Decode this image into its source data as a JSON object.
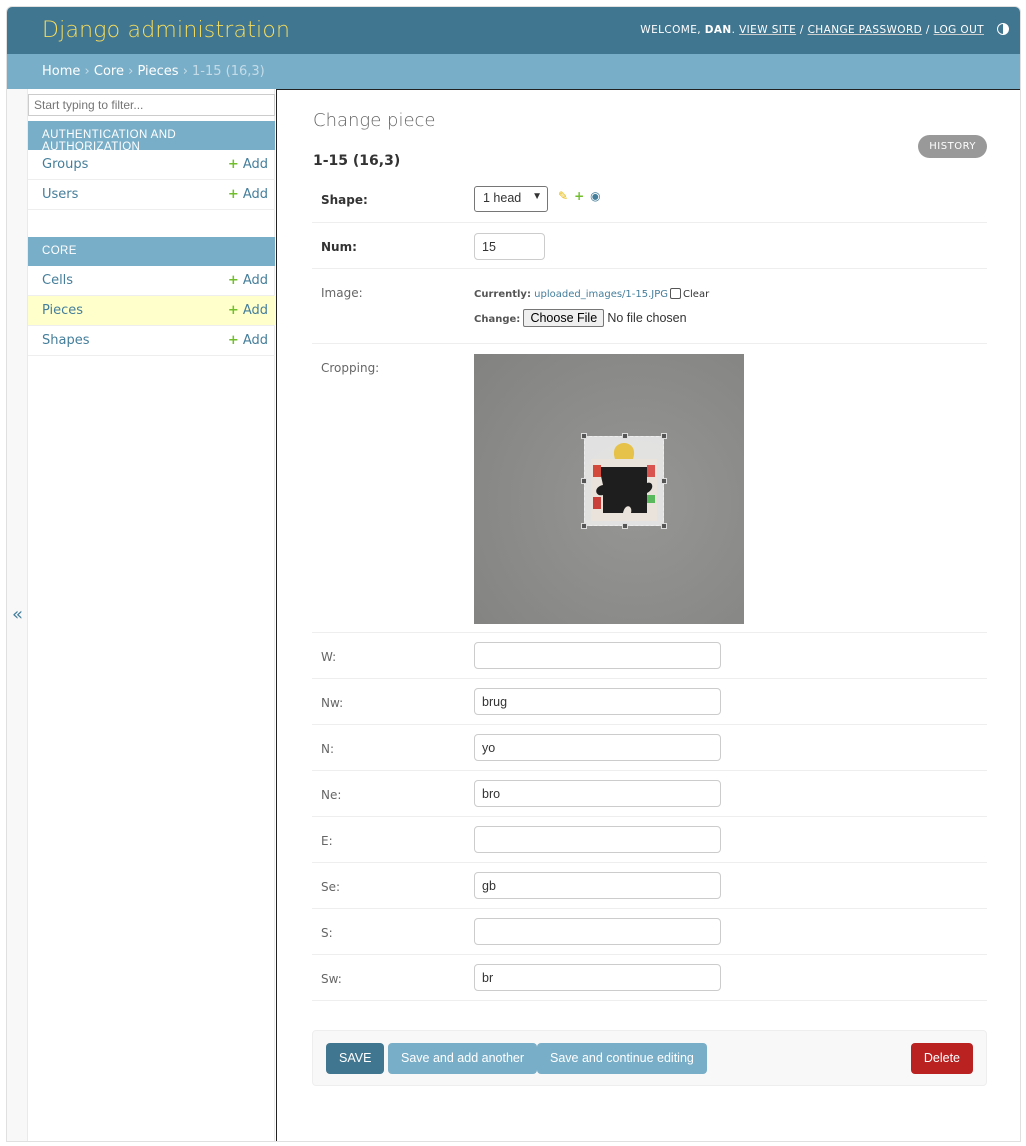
{
  "header": {
    "brand": "Django administration",
    "welcome": "WELCOME,",
    "user": "DAN",
    "view_site": "VIEW SITE",
    "change_password": "CHANGE PASSWORD",
    "log_out": "LOG OUT",
    "sep": "/",
    "theme_icon": "contrast-icon"
  },
  "breadcrumbs": [
    "Home",
    "Core",
    "Pieces",
    "1-15 (16,3)"
  ],
  "breadcrumb_sep": "›",
  "sidebar": {
    "filter_placeholder": "Start typing to filter...",
    "collapse": "«",
    "modules": [
      {
        "caption": "AUTHENTICATION AND AUTHORIZATION",
        "items": [
          {
            "name": "Groups",
            "add": "Add"
          },
          {
            "name": "Users",
            "add": "Add"
          }
        ]
      },
      {
        "caption": "CORE",
        "items": [
          {
            "name": "Cells",
            "add": "Add"
          },
          {
            "name": "Pieces",
            "add": "Add"
          },
          {
            "name": "Shapes",
            "add": "Add"
          }
        ]
      }
    ]
  },
  "content": {
    "title": "Change piece",
    "history": "HISTORY",
    "object": "1-15 (16,3)",
    "fields": {
      "shape": {
        "label": "Shape:",
        "value": "1 head"
      },
      "num": {
        "label": "Num:",
        "value": "15"
      },
      "image": {
        "label": "Image:",
        "currently": "Currently:",
        "file": "uploaded_images/1-15.JPG",
        "clear": "Clear",
        "change": "Change:",
        "choose": "Choose File",
        "no_file": "No file chosen"
      },
      "cropping": {
        "label": "Cropping:"
      },
      "w": {
        "label": "W:",
        "value": ""
      },
      "nw": {
        "label": "Nw:",
        "value": "brug"
      },
      "n": {
        "label": "N:",
        "value": "yo"
      },
      "ne": {
        "label": "Ne:",
        "value": "bro"
      },
      "e": {
        "label": "E:",
        "value": ""
      },
      "se": {
        "label": "Se:",
        "value": "gb"
      },
      "s": {
        "label": "S:",
        "value": ""
      },
      "sw": {
        "label": "Sw:",
        "value": "br"
      }
    },
    "buttons": {
      "save": "SAVE",
      "save_add": "Save and add another",
      "save_continue": "Save and continue editing",
      "delete": "Delete"
    }
  },
  "colors": {
    "header": "#417690",
    "brand": "#f5dd5d",
    "accent": "#79aec8",
    "delete": "#ba2121",
    "selected_row": "#ffffcc"
  }
}
